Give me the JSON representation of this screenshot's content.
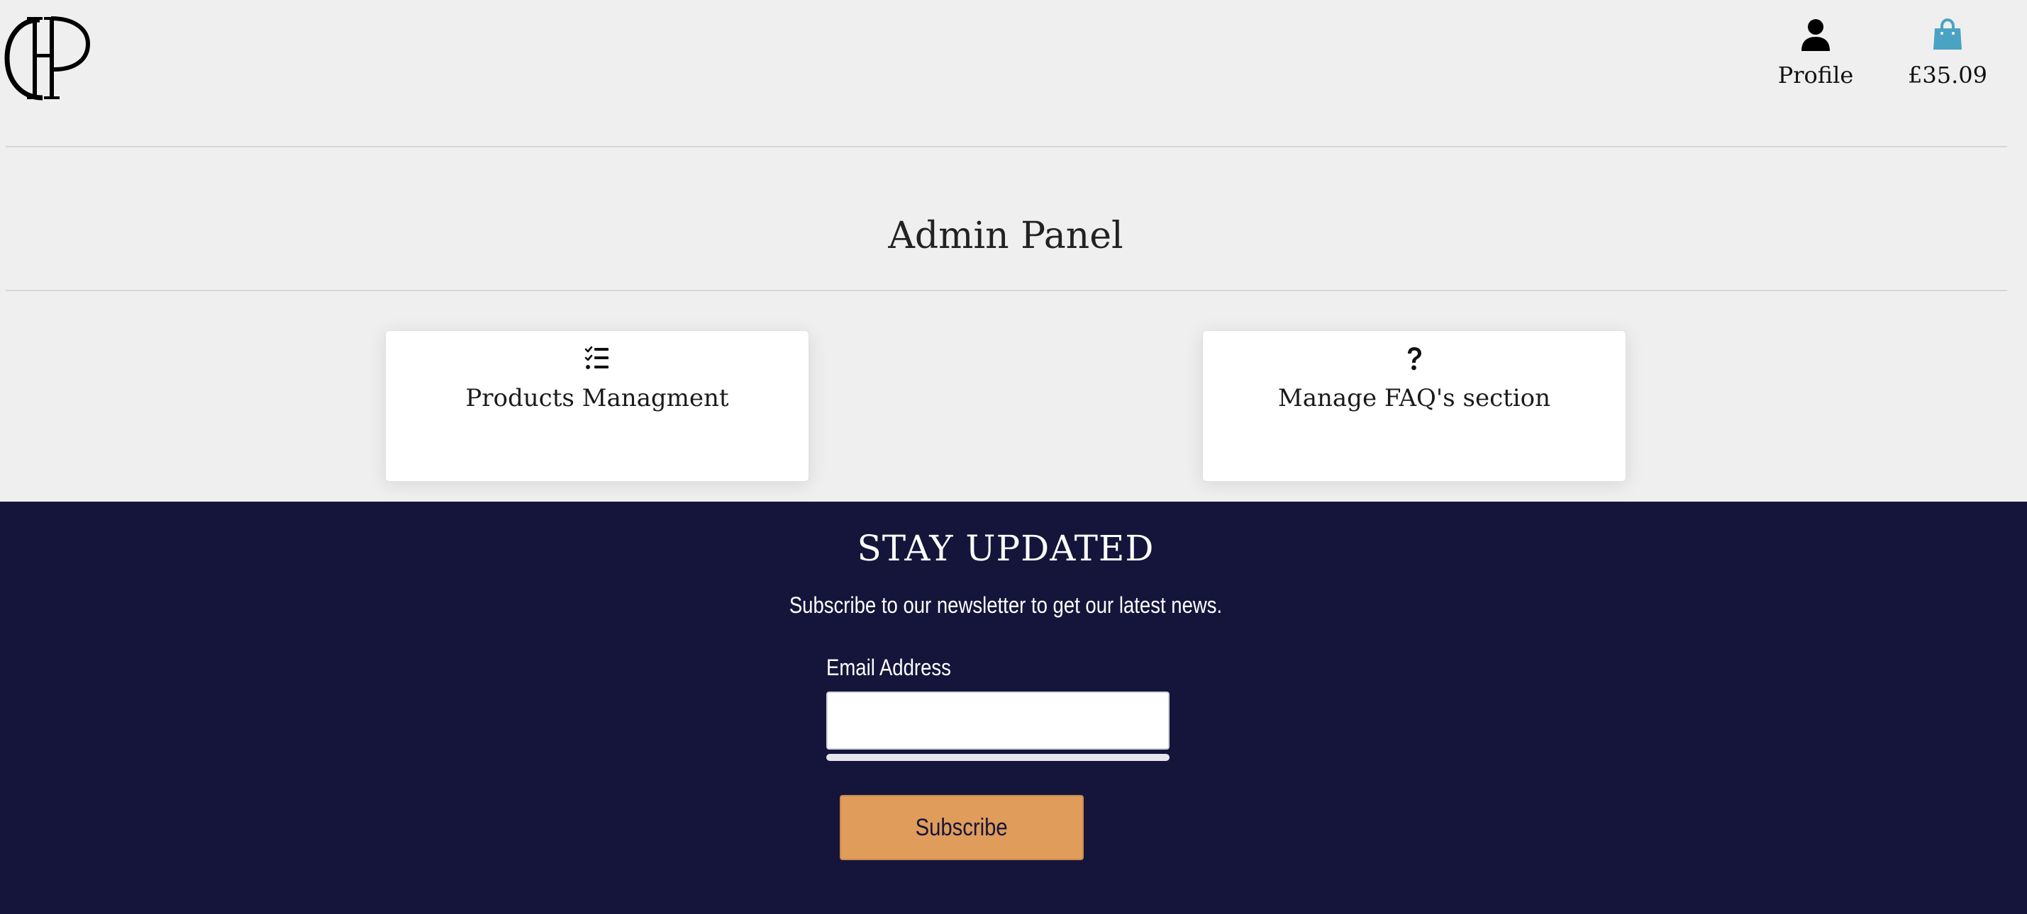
{
  "header": {
    "logo_text": "HP",
    "profile_label": "Profile",
    "bag_total": "£35.09",
    "bag_color": "#4aa3c3"
  },
  "main": {
    "title": "Admin Panel",
    "cards": [
      {
        "label": "Products Managment",
        "icon": "checklist-icon"
      },
      {
        "label": "Manage FAQ's section",
        "icon": "question-icon"
      }
    ]
  },
  "footer": {
    "title": "STAY UPDATED",
    "subtitle": "Subscribe to our newsletter to get our latest news.",
    "email_label": "Email Address",
    "email_value": "",
    "subscribe_label": "Subscribe",
    "background": "#15153b",
    "button_color": "#e09c5a"
  }
}
